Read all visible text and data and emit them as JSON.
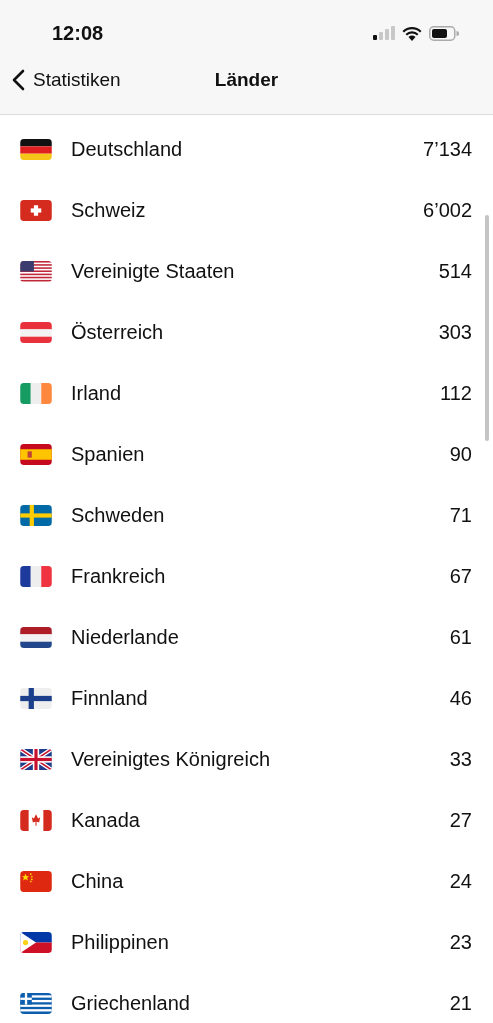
{
  "status_bar": {
    "time": "12:08"
  },
  "nav": {
    "back_label": "Statistiken",
    "title": "Länder"
  },
  "countries": [
    {
      "kind": "de",
      "name": "Deutschland",
      "count": "7’134"
    },
    {
      "kind": "ch",
      "name": "Schweiz",
      "count": "6’002"
    },
    {
      "kind": "us",
      "name": "Vereinigte Staaten",
      "count": "514"
    },
    {
      "kind": "at",
      "name": "Österreich",
      "count": "303"
    },
    {
      "kind": "ie",
      "name": "Irland",
      "count": "112"
    },
    {
      "kind": "es",
      "name": "Spanien",
      "count": "90"
    },
    {
      "kind": "se",
      "name": "Schweden",
      "count": "71"
    },
    {
      "kind": "fr",
      "name": "Frankreich",
      "count": "67"
    },
    {
      "kind": "nl",
      "name": "Niederlande",
      "count": "61"
    },
    {
      "kind": "fi",
      "name": "Finnland",
      "count": "46"
    },
    {
      "kind": "gb",
      "name": "Vereinigtes Königreich",
      "count": "33"
    },
    {
      "kind": "ca",
      "name": "Kanada",
      "count": "27"
    },
    {
      "kind": "cn",
      "name": "China",
      "count": "24"
    },
    {
      "kind": "ph",
      "name": "Philippinen",
      "count": "23"
    },
    {
      "kind": "gr",
      "name": "Griechenland",
      "count": "21"
    }
  ]
}
